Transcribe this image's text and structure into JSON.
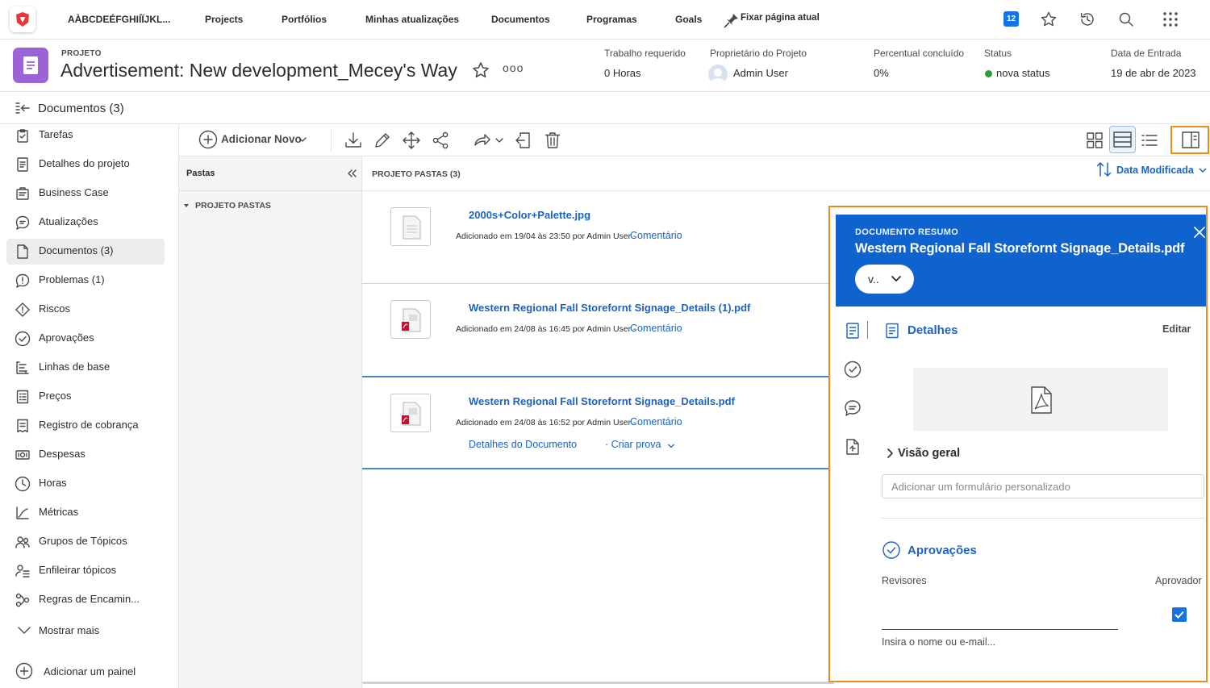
{
  "topnav": {
    "org_name": "AÀBCDEÉFGHIÍÏJKL...",
    "items": [
      "Projects",
      "Portfólios",
      "Minhas atualizações",
      "Documentos",
      "Programas",
      "Goals"
    ],
    "pin_label": "Fixar página atual",
    "notification_count": "12"
  },
  "project": {
    "eyebrow": "PROJETO",
    "title": "Advertisement: New development_Mecey's Way",
    "more": "ooo",
    "fields": [
      {
        "label": "Trabalho requerido",
        "value": "0 Horas"
      },
      {
        "label": "Proprietário do Projeto",
        "value": "Admin User"
      },
      {
        "label": "Percentual concluído",
        "value": "0%"
      },
      {
        "label": "Status",
        "value": "nova status"
      },
      {
        "label": "Data de Entrada",
        "value": "19 de abr de 2023"
      }
    ],
    "status_color": "#2d9d3a"
  },
  "docs_title": "Documentos (3)",
  "sidebar": {
    "items": [
      {
        "label": "Tarefas",
        "icon": "clipboard-icon"
      },
      {
        "label": "Detalhes do projeto",
        "icon": "document-icon"
      },
      {
        "label": "Business Case",
        "icon": "business-case-icon"
      },
      {
        "label": "Atualizações",
        "icon": "chat-bubble-icon"
      },
      {
        "label": "Documentos (3)",
        "icon": "page-icon"
      },
      {
        "label": "Problemas (1)",
        "icon": "alert-bubble-icon"
      },
      {
        "label": "Riscos",
        "icon": "risk-diamond-icon"
      },
      {
        "label": "Aprovações",
        "icon": "check-circle-icon"
      },
      {
        "label": "Linhas de base",
        "icon": "baseline-icon"
      },
      {
        "label": "Preços",
        "icon": "price-list-icon"
      },
      {
        "label": "Registro de cobrança",
        "icon": "billing-icon"
      },
      {
        "label": "Despesas",
        "icon": "money-icon"
      },
      {
        "label": "Horas",
        "icon": "clock-icon"
      },
      {
        "label": "Métricas",
        "icon": "metrics-icon"
      },
      {
        "label": "Grupos de Tópicos",
        "icon": "topic-groups-icon"
      },
      {
        "label": "Enfileirar tópicos",
        "icon": "queue-topics-icon"
      },
      {
        "label": "Regras de Encamin...",
        "icon": "routing-rules-icon"
      }
    ],
    "show_more": "Mostrar mais",
    "add_panel": "Adicionar um painel"
  },
  "toolbar": {
    "add_new": "Adicionar Novo",
    "sort_label": "Data Modificada"
  },
  "folders": {
    "header": "Pastas",
    "root": "PROJETO PASTAS"
  },
  "list": {
    "header": "PROJETO PASTAS (3)",
    "rows": [
      {
        "name": "2000s+Color+Palette.jpg",
        "meta": "Adicionado em 19/04 às 23:50 por Admin User -",
        "comment": "Comentário"
      },
      {
        "name": "Western Regional Fall Storefornt Signage_Details (1).pdf",
        "meta": "Adicionado em 24/08 às 16:45 por Admin User -",
        "comment": "Comentário"
      },
      {
        "name": "Western Regional Fall Storefornt Signage_Details.pdf",
        "meta": "Adicionado em 24/08 às 16:52 por Admin User -",
        "comment": "Comentário",
        "details_link": "Detalhes do Documento",
        "proof_link": "· Criar prova"
      }
    ]
  },
  "summary": {
    "eyebrow": "DOCUMENTO RESUMO",
    "title": "Western Regional Fall Storefornt Signage_Details.pdf",
    "version": "v..",
    "details_title": "Detalhes",
    "edit": "Editar",
    "overview": "Visão geral",
    "custom_form_placeholder": "Adicionar um formulário personalizado",
    "approvals_title": "Aprovações",
    "reviewers_label": "Revisores",
    "approver_label": "Aprovador",
    "name_input_placeholder": "Insira o nome ou e-mail..."
  },
  "colors": {
    "accent": "#1473e6",
    "link": "#1b62c9",
    "panel_header": "#0e63cf",
    "highlight": "#f08c1e",
    "project_icon": "#9b63d6"
  }
}
